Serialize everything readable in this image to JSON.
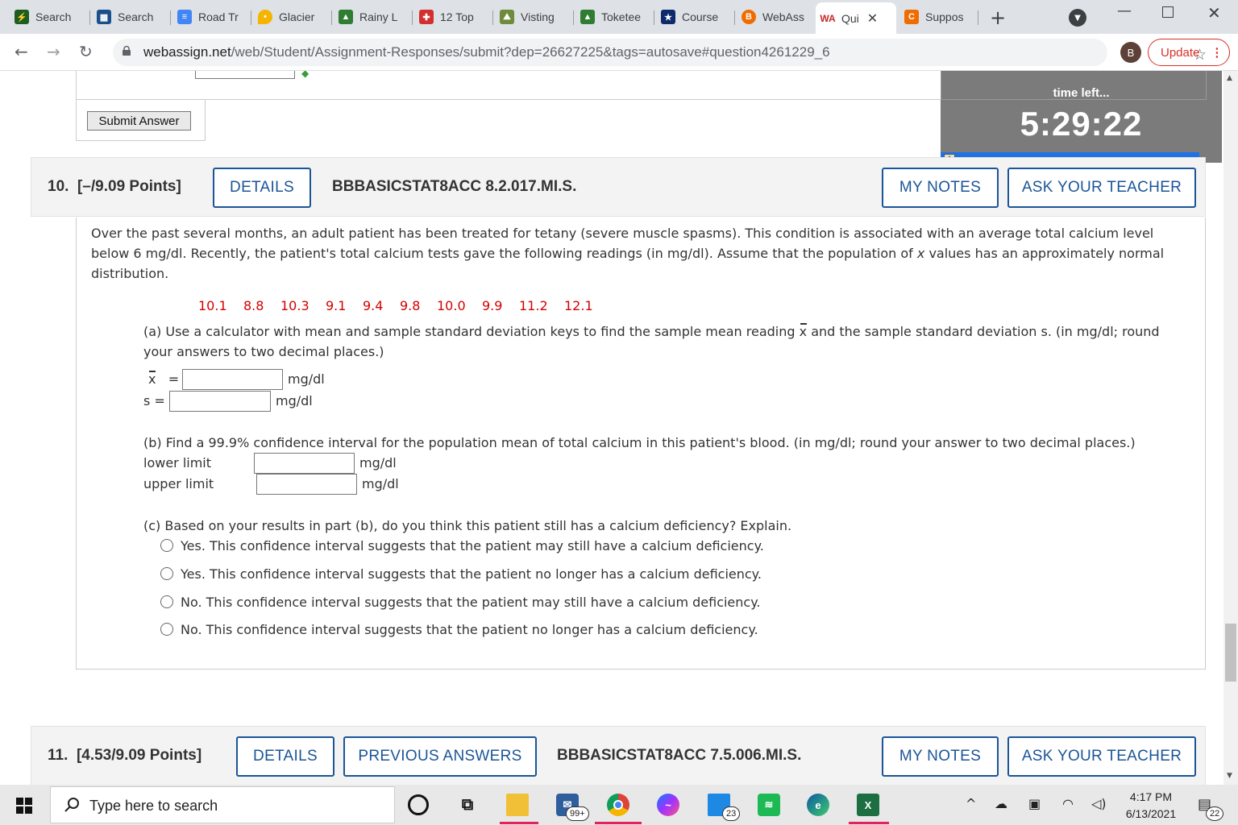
{
  "browser": {
    "tabs": [
      {
        "label": "Search",
        "icon": "zap-favicon",
        "color": "#1b5e20"
      },
      {
        "label": "Search",
        "icon": "library-favicon",
        "color": "#1a4f8b"
      },
      {
        "label": "Road Tr",
        "icon": "docs-favicon",
        "color": "#4285f4"
      },
      {
        "label": "Glacier",
        "icon": "map-pin-favicon",
        "color": "#f4b400"
      },
      {
        "label": "Rainy L",
        "icon": "alltrails-favicon",
        "color": "#2e7d32"
      },
      {
        "label": "12 Top",
        "icon": "red-logo-favicon",
        "color": "#d32f2f"
      },
      {
        "label": "Visting",
        "icon": "landscape-favicon",
        "color": "#6d8b3a"
      },
      {
        "label": "Toketee",
        "icon": "alltrails-favicon",
        "color": "#2e7d32"
      },
      {
        "label": "Course",
        "icon": "star-favicon",
        "color": "#0d2b6b"
      },
      {
        "label": "WebAss",
        "icon": "b-favicon",
        "color": "#ef6c00"
      },
      {
        "label": "Qui",
        "icon": "webassign-favicon",
        "color": "#c62828"
      },
      {
        "label": "Suppos",
        "icon": "c-favicon",
        "color": "#ef6c00"
      }
    ],
    "url_host": "webassign.net",
    "url_path": "/web/Student/Assignment-Responses/submit?dep=26627225&tags=autosave#question4261229_6",
    "profile_initial": "B",
    "update_label": "Update"
  },
  "prev": {
    "submit_label": "Submit Answer"
  },
  "timer": {
    "label": "time left...",
    "clock": "5:29:22",
    "progress": 0.92
  },
  "q10": {
    "number": "10.",
    "points": "[–/9.09 Points]",
    "details_label": "DETAILS",
    "code": "BBBASICSTAT8ACC 8.2.017.MI.S.",
    "notes_label": "MY NOTES",
    "ask_label": "ASK YOUR TEACHER",
    "intro_lines": [
      "Over the past several months, an adult patient has been treated for tetany (severe muscle spasms). This condition is associated with an average total calcium level",
      "below 6 mg/dl. Recently, the patient's total calcium tests gave the following readings (in mg/dl). Assume that the population of x values has an approximately normal",
      "distribution."
    ],
    "readings": [
      "10.1",
      "8.8",
      "10.3",
      "9.1",
      "9.4",
      "9.8",
      "10.0",
      "9.9",
      "11.2",
      "12.1"
    ],
    "part_a_lines": [
      "(a) Use a calculator with mean and sample standard deviation keys to find the sample mean reading",
      "and the sample standard deviation s. (in mg/dl; round",
      "your answers to two decimal places.)"
    ],
    "xbar_symbol": "x",
    "s_label": "s =",
    "equals": "=",
    "unit": "mg/dl",
    "xbar_value": "",
    "s_value": "",
    "part_b_line": "(b) Find a 99.9% confidence interval for the population mean of total calcium in this patient's blood. (in mg/dl; round your answer to two decimal places.)",
    "lower_label": "lower limit",
    "upper_label": "upper limit",
    "lower_value": "",
    "upper_value": "",
    "part_c_line": "(c) Based on your results in part (b), do you think this patient still has a calcium deficiency? Explain.",
    "options": [
      "Yes. This confidence interval suggests that the patient may still have a calcium deficiency.",
      "Yes. This confidence interval suggests that the patient no longer has a calcium deficiency.",
      "No. This confidence interval suggests that the patient may still have a calcium deficiency.",
      "No. This confidence interval suggests that the patient no longer has a calcium deficiency."
    ]
  },
  "q11": {
    "number": "11.",
    "points": "[4.53/9.09 Points]",
    "details_label": "DETAILS",
    "previous_label": "PREVIOUS ANSWERS",
    "code": "BBBASICSTAT8ACC 7.5.006.MI.S.",
    "notes_label": "MY NOTES",
    "ask_label": "ASK YOUR TEACHER"
  },
  "taskbar": {
    "search_placeholder": "Type here to search",
    "mail_badge": "99+",
    "calendar_badge": "23",
    "time": "4:17 PM",
    "date": "6/13/2021",
    "notification_count": "22"
  }
}
